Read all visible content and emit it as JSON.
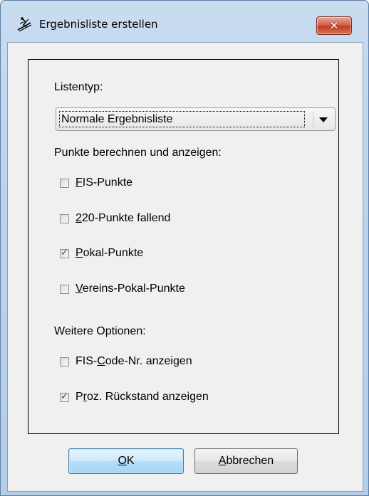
{
  "window": {
    "title": "Ergebnisliste erstellen",
    "close_label": "x"
  },
  "list_type": {
    "label": "Listentyp:",
    "selected": "Normale Ergebnisliste"
  },
  "points_section": {
    "label": "Punkte berechnen und anzeigen:",
    "options": [
      {
        "mnemonic": "F",
        "rest": "IS-Punkte",
        "checked": false
      },
      {
        "mnemonic": "2",
        "rest": "20-Punkte fallend",
        "checked": false
      },
      {
        "mnemonic": "P",
        "rest": "okal-Punkte",
        "checked": true
      },
      {
        "mnemonic": "V",
        "rest": "ereins-Pokal-Punkte",
        "checked": false
      }
    ]
  },
  "more_options": {
    "label": "Weitere Optionen:",
    "options": [
      {
        "before": "FIS-",
        "mnemonic": "C",
        "rest": "ode-Nr. anzeigen",
        "checked": false
      },
      {
        "before": "P",
        "mnemonic": "r",
        "rest": "oz. Rückstand anzeigen",
        "checked": true
      }
    ]
  },
  "buttons": {
    "ok": {
      "mnemonic": "O",
      "rest": "K"
    },
    "cancel": {
      "mnemonic": "A",
      "rest": "bbrechen"
    }
  },
  "colors": {
    "close_button": "#c23d26",
    "default_button": "#a8d6f4",
    "check_mark": "#2b4c8c"
  }
}
